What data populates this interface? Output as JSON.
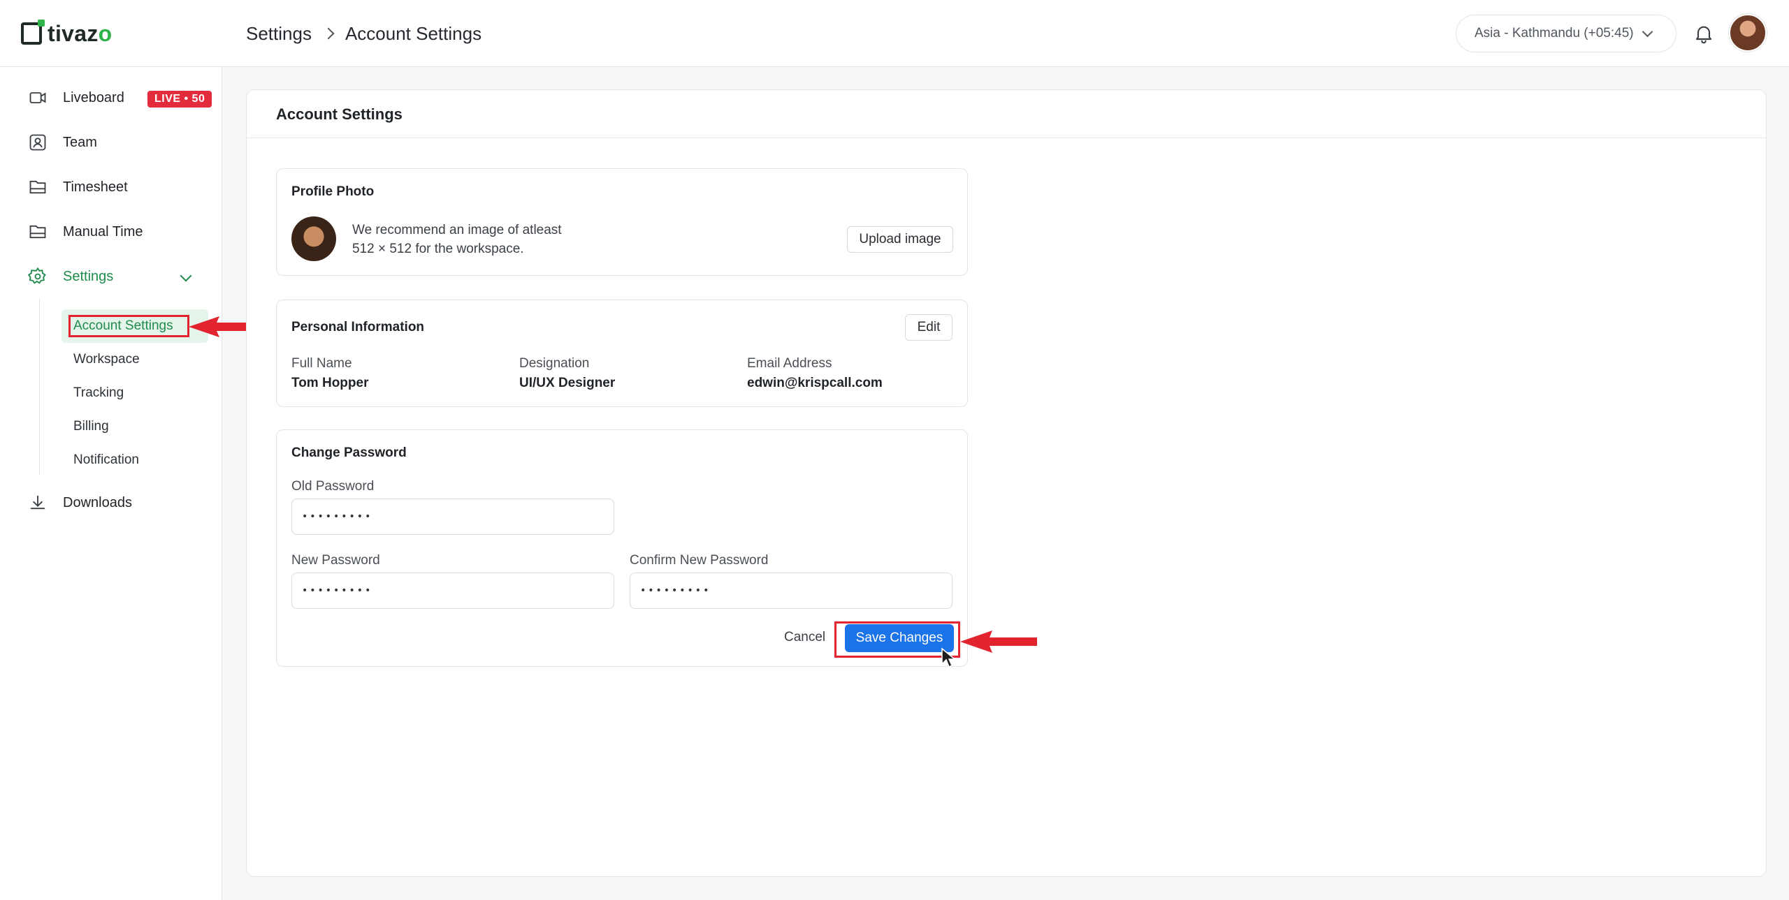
{
  "app": {
    "name": "tivazo",
    "logo_text_prefix": "tivaz",
    "logo_text_suffix": "o"
  },
  "header": {
    "breadcrumb": [
      "Settings",
      "Account Settings"
    ],
    "timezone": "Asia - Kathmandu (+05:45)"
  },
  "sidebar": {
    "items": [
      {
        "label": "Liveboard",
        "icon": "video-icon",
        "badge": "LIVE • 50"
      },
      {
        "label": "Team",
        "icon": "team-icon"
      },
      {
        "label": "Timesheet",
        "icon": "timesheet-icon"
      },
      {
        "label": "Manual Time",
        "icon": "manual-time-icon"
      },
      {
        "label": "Settings",
        "icon": "gear-icon",
        "active": true
      },
      {
        "label": "Downloads",
        "icon": "download-icon"
      }
    ],
    "settings_sub": [
      "Account Settings",
      "Workspace",
      "Tracking",
      "Billing",
      "Notification"
    ],
    "active_sub": "Account Settings"
  },
  "main": {
    "title": "Account Settings",
    "profile_photo": {
      "title": "Profile Photo",
      "hint_line1": "We recommend an image of atleast",
      "hint_line2": "512 × 512 for the workspace.",
      "upload_label": "Upload image"
    },
    "personal_info": {
      "title": "Personal Information",
      "edit_label": "Edit",
      "fields": [
        {
          "label": "Full Name",
          "value": "Tom Hopper"
        },
        {
          "label": "Designation",
          "value": "UI/UX Designer"
        },
        {
          "label": "Email Address",
          "value": "edwin@krispcall.com"
        }
      ]
    },
    "change_password": {
      "title": "Change Password",
      "old_label": "Old Password",
      "old_value": "•••••••••",
      "new_label": "New Password",
      "new_value": "•••••••••",
      "confirm_label": "Confirm New Password",
      "confirm_value": "•••••••••",
      "cancel_label": "Cancel",
      "save_label": "Save Changes"
    }
  },
  "colors": {
    "accent_green": "#1e8b4c",
    "primary_blue": "#1a73e8",
    "annotation_red": "#e2242f",
    "live_red": "#e32c3b"
  }
}
